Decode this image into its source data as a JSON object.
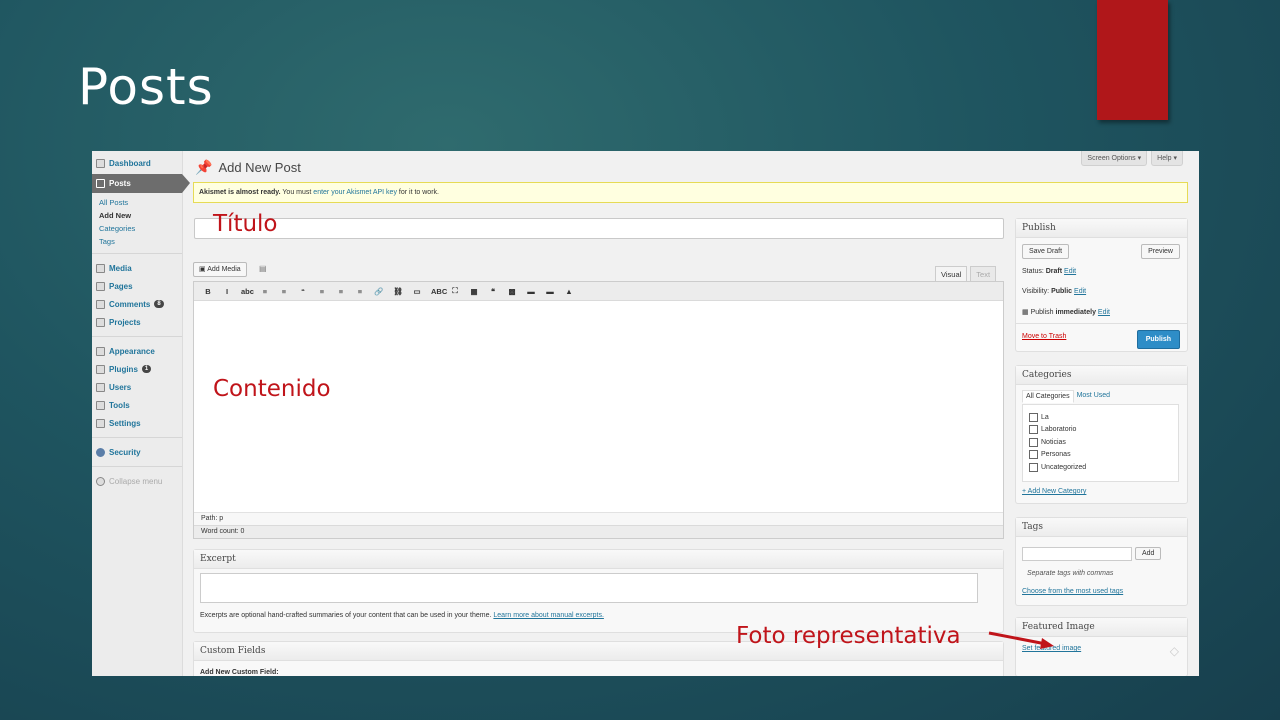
{
  "slide": {
    "title": "Posts"
  },
  "sidebar": {
    "items": [
      {
        "label": "Dashboard"
      },
      {
        "label": "Posts"
      },
      {
        "label": "Media"
      },
      {
        "label": "Pages"
      },
      {
        "label": "Comments",
        "badge": "8"
      },
      {
        "label": "Projects"
      },
      {
        "label": "Appearance"
      },
      {
        "label": "Plugins",
        "badge": "1"
      },
      {
        "label": "Users"
      },
      {
        "label": "Tools"
      },
      {
        "label": "Settings"
      },
      {
        "label": "Security"
      },
      {
        "label": "Collapse menu"
      }
    ],
    "posts_sub": [
      "All Posts",
      "Add New",
      "Categories",
      "Tags"
    ]
  },
  "header": {
    "screen_options": "Screen Options ▾",
    "help": "Help ▾",
    "page_title": "Add New Post"
  },
  "notice": {
    "bold": "Akismet is almost ready.",
    "text1": "You must",
    "link": "enter your Akismet API key",
    "text2": "for it to work."
  },
  "editor": {
    "title_overlay": "Título",
    "add_media": "Add Media",
    "tab_visual": "Visual",
    "tab_text": "Text",
    "toolbar": [
      "B",
      "I",
      "abc",
      "≡",
      "≡",
      "“",
      "≡",
      "≡",
      "≡",
      "🔗",
      "⛓",
      "▭",
      "ABC",
      "⛶",
      "▦",
      "❝",
      "▩",
      "▬",
      "▬",
      "▲"
    ],
    "content_overlay": "Contenido",
    "path": "Path: p",
    "word_count": "Word count: 0"
  },
  "excerpt": {
    "title": "Excerpt",
    "help": "Excerpts are optional hand-crafted summaries of your content that can be used in your theme.",
    "link": "Learn more about manual excerpts."
  },
  "custom_fields": {
    "title": "Custom Fields",
    "label": "Add New Custom Field:"
  },
  "publish": {
    "title": "Publish",
    "save_draft": "Save Draft",
    "preview": "Preview",
    "status_label": "Status:",
    "status_value": "Draft",
    "visibility_label": "Visibility:",
    "visibility_value": "Public",
    "publish_label": "Publish",
    "publish_value": "immediately",
    "edit": "Edit",
    "trash": "Move to Trash",
    "publish_button": "Publish"
  },
  "categories": {
    "title": "Categories",
    "tab_all": "All Categories",
    "tab_used": "Most Used",
    "items": [
      "La",
      "Laboratorio",
      "Noticias",
      "Personas",
      "Uncategorized"
    ],
    "add_new": "+ Add New Category"
  },
  "tags": {
    "title": "Tags",
    "add": "Add",
    "hint": "Separate tags with commas",
    "choose": "Choose from the most used tags"
  },
  "featured": {
    "title": "Featured Image",
    "link": "Set featured image",
    "overlay": "Foto representativa"
  },
  "colors": {
    "accent_red": "#c0141a",
    "wp_link": "#21759b",
    "publish_blue": "#2e8dc7"
  }
}
